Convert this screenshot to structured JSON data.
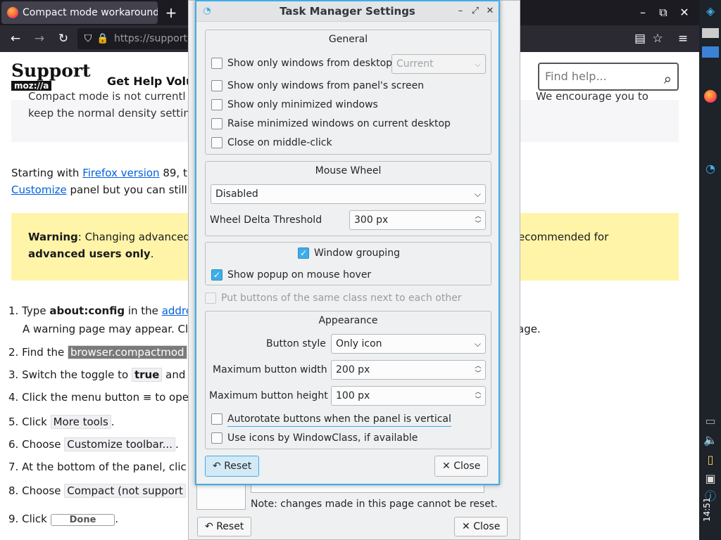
{
  "browser": {
    "tab_title": "Compact mode workaround",
    "new_tab": "+",
    "url": "https://support",
    "window_min": "–",
    "window_restore": "⧉",
    "window_close": "✕"
  },
  "page": {
    "logo_support": "Support",
    "logo_mozilla": "moz://a",
    "nav_get_help": "Get Help",
    "nav_volunteer": "Volu",
    "search_placeholder": "Find help...",
    "notice_line1": "Compact mode is not currentl",
    "notice_line1_right": "We encourage you to",
    "notice_line2": "keep the normal density settin",
    "intro_prefix": "Starting with ",
    "intro_link": "Firefox version",
    "intro_suffix": " 89, t",
    "intro_line2_link": "Customize",
    "intro_line2_rest": " panel but you can still",
    "warning_label": "Warning",
    "warning_text": ": Changing advanced",
    "warning_right": "ecommended for",
    "warning_line2_bold": "advanced users only",
    "warning_line2_end": ".",
    "steps": [
      {
        "num": "1.",
        "pre": "Type ",
        "bold": "about:config",
        "mid": " in the ",
        "link": "addre"
      },
      {
        "num": "",
        "pre": "A warning page may appear. Cl",
        "right": "age."
      },
      {
        "num": "2.",
        "pre": "Find the ",
        "code": "browser.compactmod"
      },
      {
        "num": "3.",
        "pre": "Switch the toggle to ",
        "code": "true",
        "post": " and"
      },
      {
        "num": "4.",
        "pre": "Click the menu button ",
        "glyph": "≡",
        "post": " to ope"
      },
      {
        "num": "5.",
        "pre": "Click ",
        "code": "More tools",
        "post": "."
      },
      {
        "num": "6.",
        "pre": "Choose ",
        "code": "Customize toolbar...",
        "post": "."
      },
      {
        "num": "7.",
        "pre": "At the bottom of the panel, clic"
      },
      {
        "num": "8.",
        "pre": "Choose ",
        "code": "Compact (not support"
      },
      {
        "num": "9.",
        "pre": "Click ",
        "button": "Done",
        "post": "."
      }
    ]
  },
  "bg_dialog": {
    "note": "Note: changes made in this page cannot be reset.",
    "reset_label": "Reset",
    "close_label": "Close"
  },
  "dialog": {
    "title": "Task Manager Settings",
    "general": {
      "title": "General",
      "show_only_desktop": "Show only windows from desktop",
      "desktop_combo": "Current",
      "show_only_screen": "Show only windows from panel's screen",
      "show_only_minimized": "Show only minimized windows",
      "raise_minimized": "Raise minimized windows on current desktop",
      "close_middle_click": "Close on middle-click"
    },
    "mouse_wheel": {
      "title": "Mouse Wheel",
      "mode": "Disabled",
      "threshold_label": "Wheel Delta Threshold",
      "threshold_value": "300 px"
    },
    "grouping": {
      "window_grouping": "Window grouping",
      "window_grouping_checked": true,
      "show_popup": "Show popup on mouse hover",
      "show_popup_checked": true
    },
    "put_buttons_same_class": "Put buttons of the same class next to each other",
    "appearance": {
      "title": "Appearance",
      "button_style_label": "Button style",
      "button_style_value": "Only icon",
      "max_width_label": "Maximum button width",
      "max_width_value": "200 px",
      "max_height_label": "Maximum button height",
      "max_height_value": "100 px",
      "autorotate": "Autorotate buttons when the panel is vertical",
      "use_icons": "Use icons by WindowClass, if available"
    },
    "reset_label": "Reset",
    "close_label": "Close"
  },
  "taskbar": {
    "clock": "14:51"
  },
  "colors": {
    "accent": "#3daee9",
    "browser_dark": "#1c1b22",
    "link": "#0060df",
    "warning_bg": "#fff4a8"
  }
}
